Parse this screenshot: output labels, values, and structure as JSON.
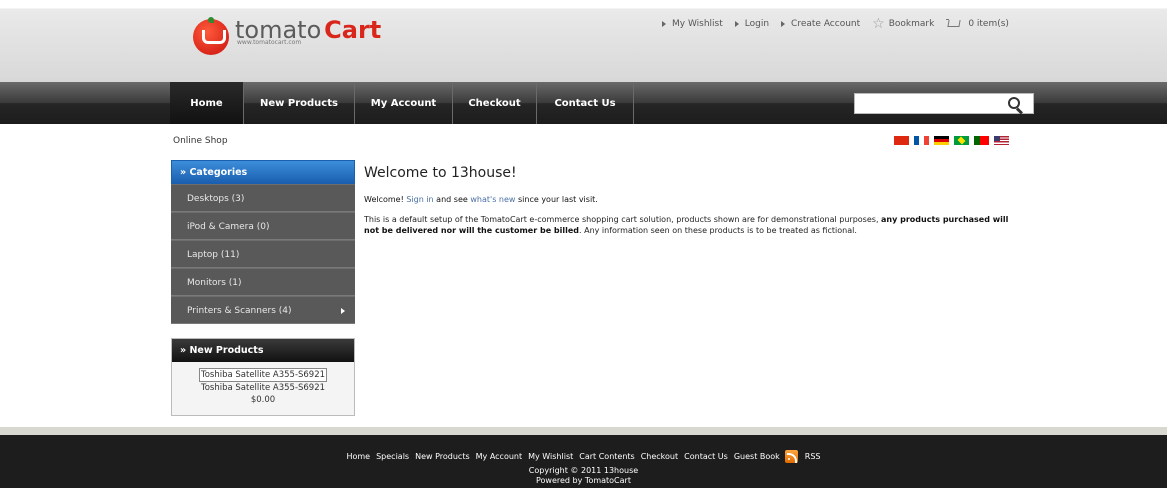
{
  "header": {
    "logo_text_1": "tomato",
    "logo_text_2": "Cart",
    "logo_url": "www.tomatocart.com",
    "links": {
      "wishlist": "My Wishlist",
      "login": "Login",
      "create_account": "Create Account",
      "bookmark": "Bookmark",
      "cart": "0 item(s)"
    }
  },
  "nav": {
    "items": [
      "Home",
      "New Products",
      "My Account",
      "Checkout",
      "Contact Us"
    ],
    "search_placeholder": ""
  },
  "breadcrumb": "Online Shop",
  "flags": [
    "cn-flag-icon",
    "fr-flag-icon",
    "de-flag-icon",
    "br-flag-icon",
    "pt-flag-icon",
    "us-flag-icon"
  ],
  "sidebar": {
    "categories_title": "Categories",
    "categories": [
      "Desktops (3)",
      "iPod & Camera (0)",
      "Laptop (11)",
      "Monitors (1)",
      "Printers & Scanners (4)"
    ],
    "new_products_title": "New Products",
    "new_product": {
      "image_alt": "Toshiba Satellite A355-S6921",
      "name": "Toshiba Satellite A355-S6921",
      "price": "$0.00"
    }
  },
  "main": {
    "title": "Welcome to 13house!",
    "welcome_prefix": "Welcome! ",
    "sign_in": "Sign in",
    "and_see": " and see ",
    "whats_new": "what's new",
    "since": " since your last visit.",
    "intro_1": "This is a default setup of the TomatoCart e-commerce shopping cart solution, products shown are for demonstrational purposes, ",
    "intro_bold": "any products purchased will not be delivered nor will the customer be billed",
    "intro_2": ". Any information seen on these products is to be treated as fictional."
  },
  "footer": {
    "links": [
      "Home",
      "Specials",
      "New Products",
      "My Account",
      "My Wishlist",
      "Cart Contents",
      "Checkout",
      "Contact Us",
      "Guest Book"
    ],
    "rss": "RSS",
    "copyright": "Copyright © 2011 13house",
    "powered": "Powered by TomatoCart"
  },
  "colors": {
    "category_header": "#1b5fb0",
    "category_item": "#595959",
    "footer_bg": "#1d1d1d",
    "logo_red": "#d9261a"
  }
}
